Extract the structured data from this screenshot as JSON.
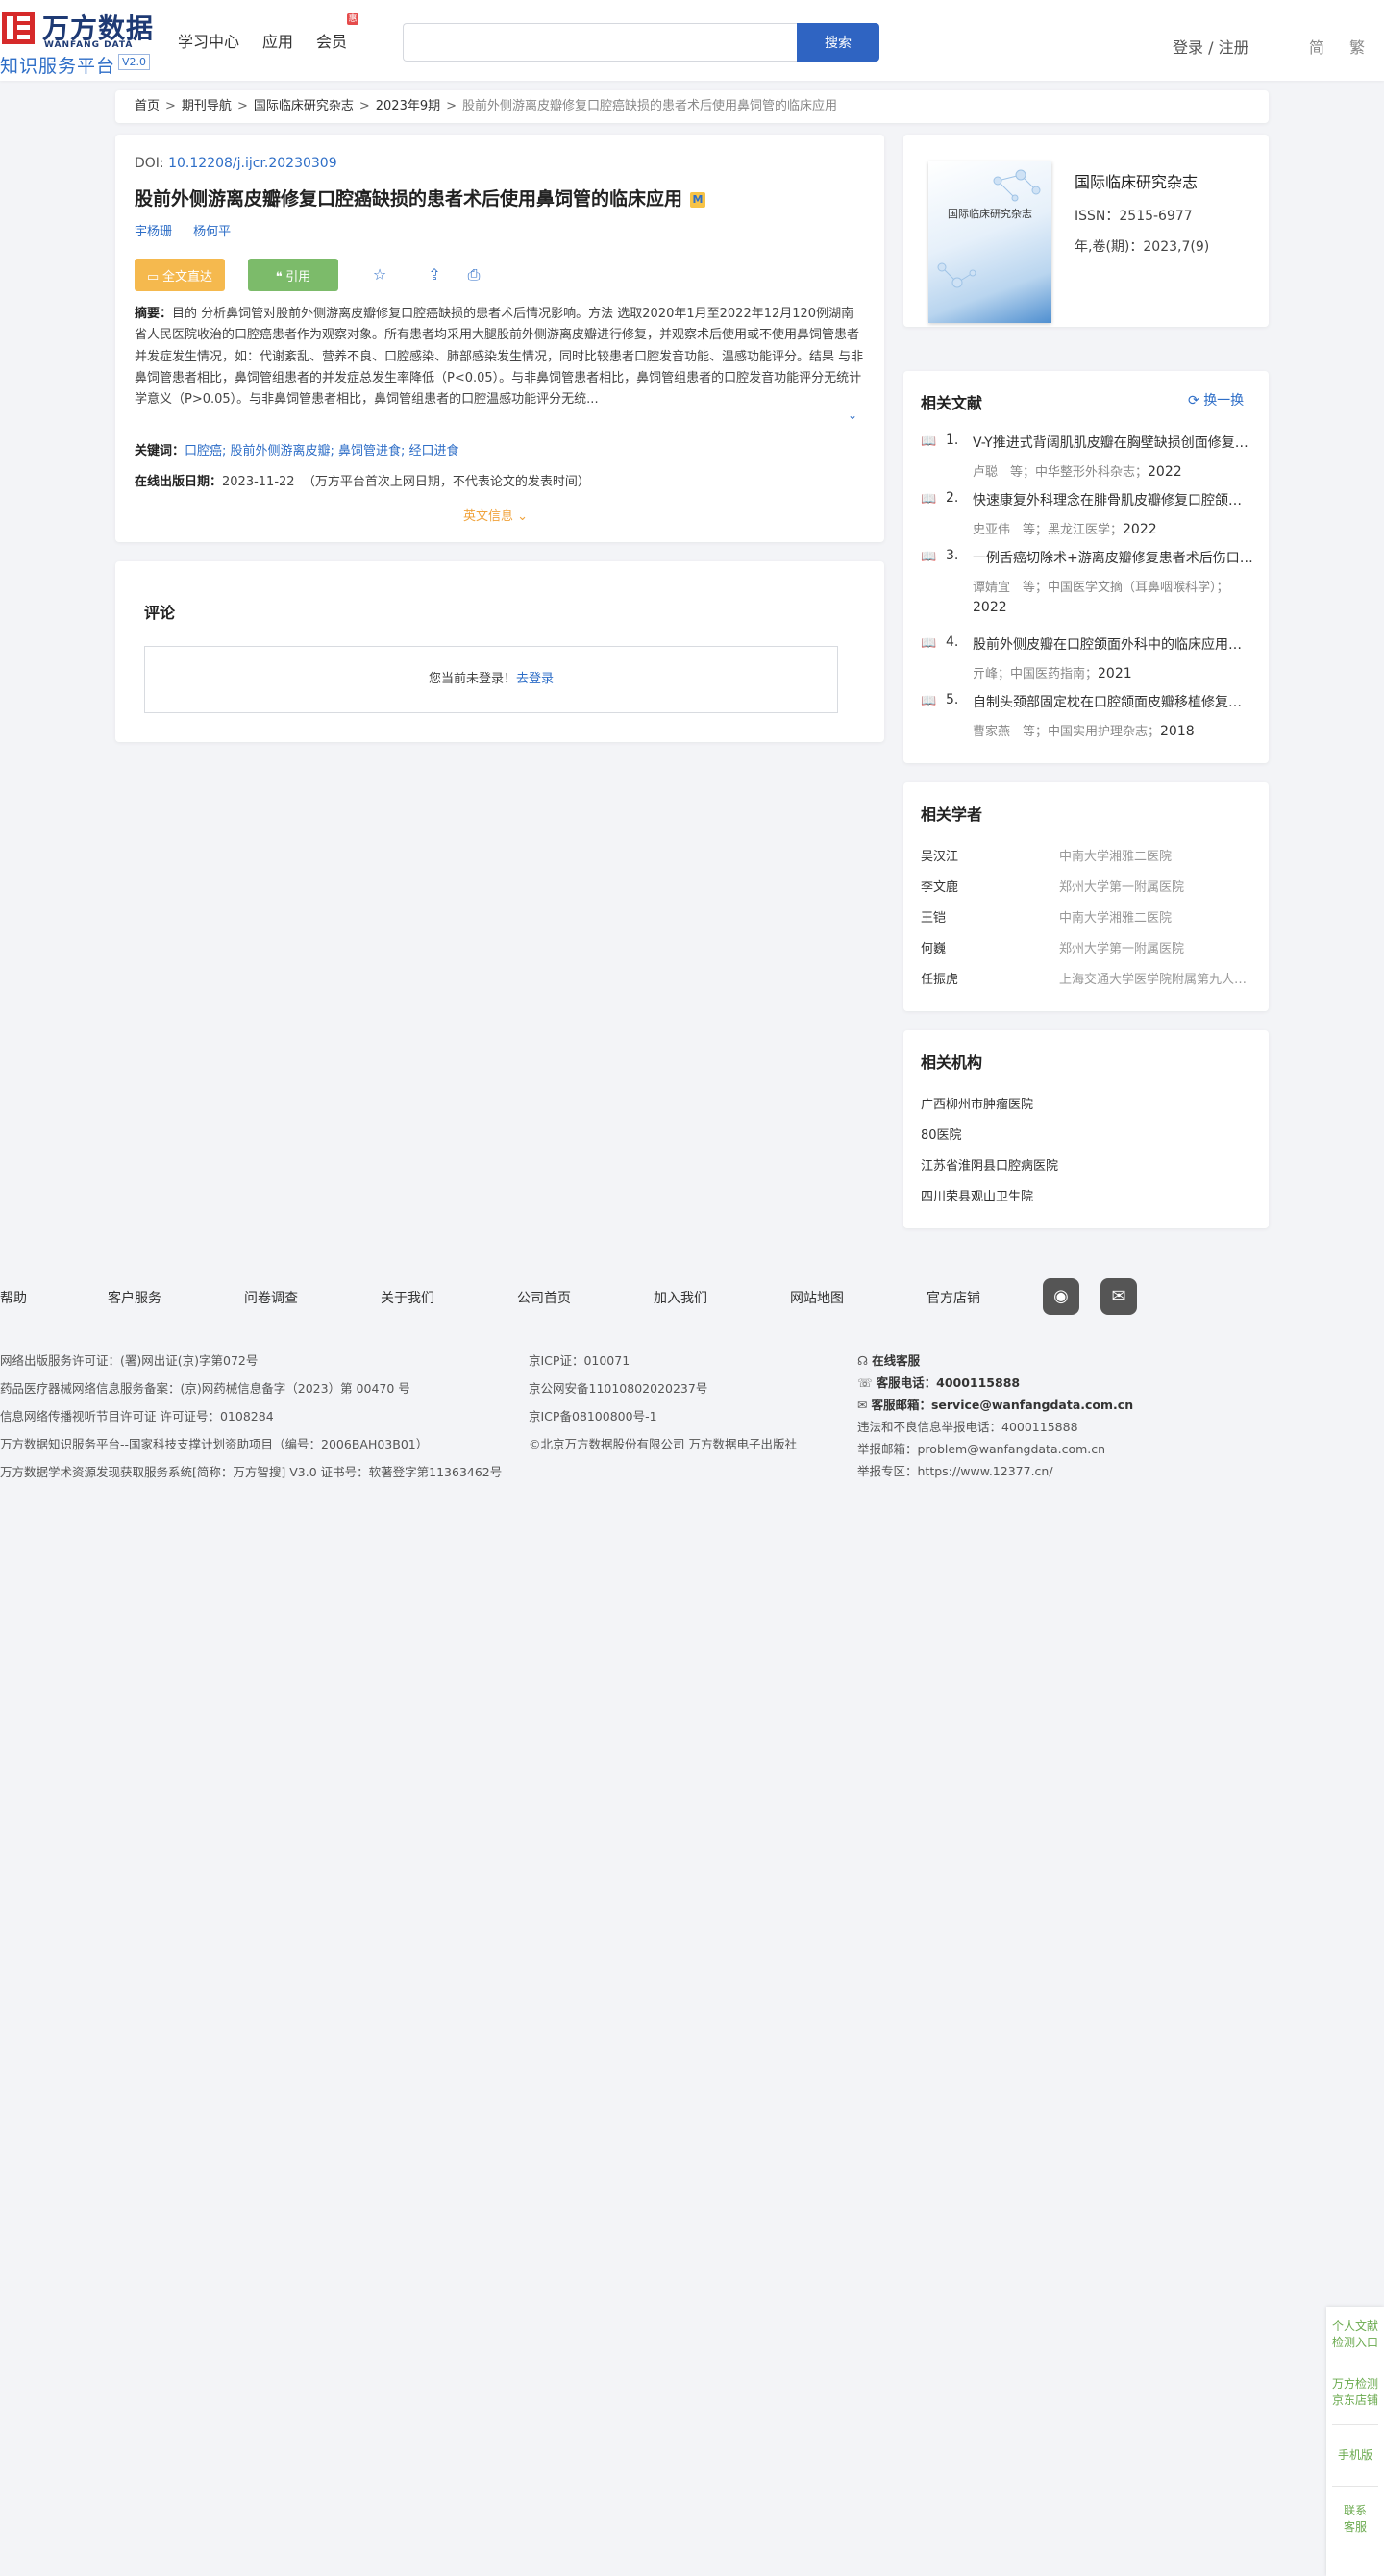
{
  "header": {
    "logo_cn": "万方数据",
    "logo_en": "WANFANG DATA",
    "logo_sub": "知识服务平台",
    "logo_version": "V2.0",
    "nav": [
      "学习中心",
      "应用",
      "会员"
    ],
    "nav_badge": "惠",
    "search_placeholder": "",
    "search_button": "搜索",
    "login": "登录 / 注册",
    "lang_simplified": "简",
    "lang_traditional": "繁"
  },
  "breadcrumb": {
    "items": [
      "首页",
      "期刊导航",
      "国际临床研究杂志",
      "2023年9期"
    ],
    "current": "股前外侧游离皮瓣修复口腔癌缺损的患者术后使用鼻饲管的临床应用"
  },
  "article": {
    "doi_label": "DOI:",
    "doi": "10.12208/j.ijcr.20230309",
    "title": "股前外侧游离皮瓣修复口腔癌缺损的患者术后使用鼻饲管的临床应用",
    "badge": "M",
    "authors": [
      "宇杨珊",
      "杨何平"
    ],
    "btn_fulltext": "全文直达",
    "btn_cite": "引用",
    "abstract_label": "摘要：",
    "abstract": "目的 分析鼻饲管对股前外侧游离皮瓣修复口腔癌缺损的患者术后情况影响。方法 选取2020年1月至2022年12月120例湖南省人民医院收治的口腔癌患者作为观察对象。所有患者均采用大腿股前外侧游离皮瓣进行修复，并观察术后使用或不使用鼻饲管患者并发症发生情况，如：代谢紊乱、营养不良、口腔感染、肺部感染发生情况，同时比较患者口腔发音功能、温感功能评分。结果 与非鼻饲管患者相比，鼻饲管组患者的并发症总发生率降低（P<0.05）。与非鼻饲管患者相比，鼻饲管组患者的口腔发音功能评分无统计学意义（P>0.05）。与非鼻饲管患者相比，鼻饲管组患者的口腔温感功能评分无统...",
    "keywords_label": "关键词：",
    "keywords": "口腔癌; 股前外侧游离皮瓣; 鼻饲管进食; 经口进食",
    "pubdate_label": "在线出版日期：",
    "pubdate": "2023-11-22",
    "pubdate_note": "（万方平台首次上网日期，不代表论文的发表时间）",
    "en_info": "英文信息"
  },
  "comment": {
    "title": "评论",
    "prompt": "您当前未登录！",
    "login_link": "去登录"
  },
  "journal": {
    "cover_title": "国际临床研究杂志",
    "name": "国际临床研究杂志",
    "issn": "ISSN：2515-6977",
    "volume": "年,卷(期)：2023,7(9)"
  },
  "related_docs": {
    "title": "相关文献",
    "refresh": "换一换",
    "items": [
      {
        "num": "1.",
        "title": "V-Y推进式背阔肌肌皮瓣在胸壁缺损创面修复中的应用",
        "meta": "卢聪　等；中华整形外科杂志；",
        "year": "2022"
      },
      {
        "num": "2.",
        "title": "快速康复外科理念在腓骨肌皮瓣修复口腔颌面缺损中的应用",
        "meta": "史亚伟　等；黑龙江医学；",
        "year": "2022"
      },
      {
        "num": "3.",
        "title": "一例舌癌切除术+游离皮瓣修复患者术后伤口护理",
        "meta": "谭婧宜　等；中国医学文摘（耳鼻咽喉科学）；",
        "year": "2022"
      },
      {
        "num": "4.",
        "title": "股前外侧皮瓣在口腔颌面外科中的临床应用研究",
        "meta": "亓峰；中国医药指南；",
        "year": "2021"
      },
      {
        "num": "5.",
        "title": "自制头颈部固定枕在口腔颌面皮瓣移植修复术后的应用",
        "meta": "曹家燕　等；中国实用护理杂志；",
        "year": "2018"
      }
    ]
  },
  "scholars": {
    "title": "相关学者",
    "items": [
      {
        "name": "吴汉江",
        "org": "中南大学湘雅二医院"
      },
      {
        "name": "李文鹿",
        "org": "郑州大学第一附属医院"
      },
      {
        "name": "王铠",
        "org": "中南大学湘雅二医院"
      },
      {
        "name": "何巍",
        "org": "郑州大学第一附属医院"
      },
      {
        "name": "任振虎",
        "org": "上海交通大学医学院附属第九人民医院"
      }
    ]
  },
  "institutions": {
    "title": "相关机构",
    "items": [
      "广西柳州市肿瘤医院",
      "80医院",
      "江苏省淮阴县口腔病医院",
      "四川荣县观山卫生院"
    ]
  },
  "footer": {
    "nav": [
      "帮助",
      "客户服务",
      "问卷调查",
      "关于我们",
      "公司首页",
      "加入我们",
      "网站地图",
      "官方店铺"
    ],
    "col1": [
      "网络出版服务许可证：(署)网出证(京)字第072号",
      "药品医疗器械网络信息服务备案：(京)网药械信息备字（2023）第 00470 号",
      "信息网络传播视听节目许可证 许可证号：0108284",
      "万方数据知识服务平台--国家科技支撑计划资助项目（编号：2006BAH03B01）",
      "万方数据学术资源发现获取服务系统[简称：万方智搜] V3.0 证书号：软著登字第11363462号"
    ],
    "col2": [
      "京ICP证：010071",
      "京公网安备11010802020237号",
      "京ICP备08100800号-1",
      "©北京万方数据股份有限公司 万方数据电子出版社"
    ],
    "online_service": "在线客服",
    "phone_label": "客服电话：",
    "phone": "4000115888",
    "email_label": "客服邮箱：",
    "email": "service@wanfangdata.com.cn",
    "report_phone": "违法和不良信息举报电话：4000115888",
    "report_email": "举报邮箱：problem@wanfangdata.com.cn",
    "report_zone": "举报专区：https://www.12377.cn/"
  },
  "float_panel": [
    "个人文献\n检测入口",
    "万方检测\n京东店铺",
    "手机版",
    "联系\n客服"
  ]
}
